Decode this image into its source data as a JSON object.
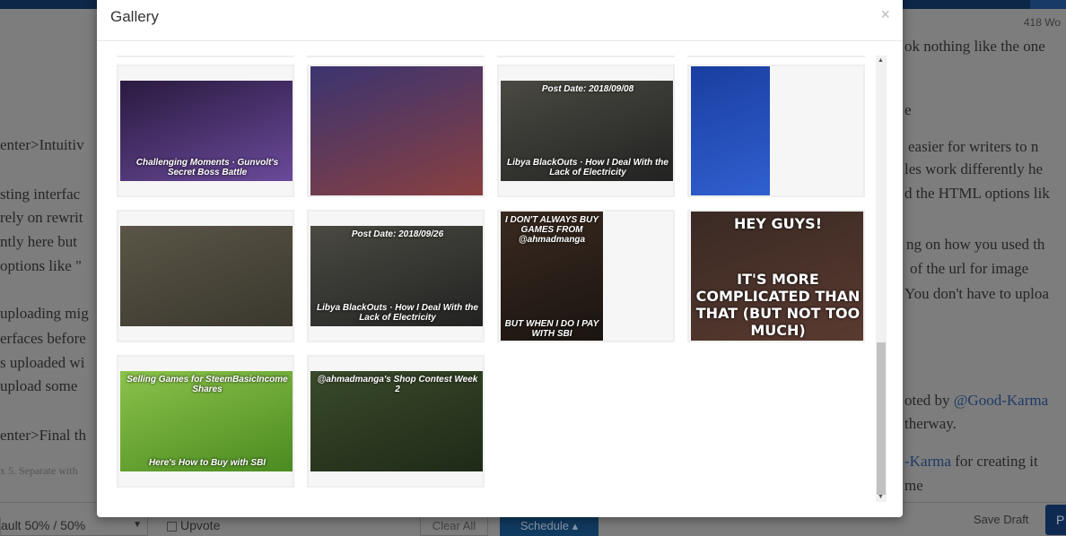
{
  "background": {
    "word_count": "418 Wo",
    "lines_left": [
      "enter>Intuitiv",
      "sting interfac",
      "rely on rewrit",
      "ntly here but",
      "options like \"",
      "uploading mig",
      "erfaces before",
      "s uploaded wi",
      "upload some",
      "enter>Final th"
    ],
    "lines_right": [
      "ok nothing like the one",
      "e",
      "easier for writers to n",
      "les work differently he",
      "d the HTML options lik",
      "ng on how you used th",
      "of the url for image",
      "You don't have to uploa",
      "oted by ",
      "therway.",
      "-Karma",
      " for creating it",
      "me"
    ],
    "link_good_karma": "@Good-Karma",
    "tags_placeholder": "x 5. Separate with",
    "beneficiary_select": "ault 50% / 50%",
    "upvote_label": "Upvote",
    "clear_all": "Clear All",
    "schedule": "Schedule ▴",
    "save_draft": "Save Draft",
    "publish": "P"
  },
  "modal": {
    "title": "Gallery",
    "close": "×",
    "images": [
      {
        "caption_top": "",
        "caption_bottom": "Challenging Moments · Gunvolt's Secret Boss Battle",
        "colors": [
          "#2a1a40",
          "#6a4a9a"
        ]
      },
      {
        "caption_top": "",
        "caption_bottom": "",
        "colors": [
          "#3b3470",
          "#8a4040"
        ]
      },
      {
        "caption_top": "Post Date: 2018/09/08",
        "caption_bottom": "Libya BlackOuts · How I Deal With the Lack of Electricity",
        "colors": [
          "#4a4a42",
          "#222"
        ]
      },
      {
        "caption_top": "",
        "caption_bottom": "",
        "colors": [
          "#1a3ea0",
          "#3060d0"
        ]
      },
      {
        "caption_top": "",
        "caption_bottom": "",
        "colors": [
          "#5a5546",
          "#3a372e"
        ]
      },
      {
        "caption_top": "Post Date: 2018/09/26",
        "caption_bottom": "Libya BlackOuts · How I Deal With the Lack of Electricity",
        "colors": [
          "#4a4a42",
          "#222"
        ]
      },
      {
        "caption_top": "I DON'T ALWAYS BUY GAMES FROM @ahmadmanga",
        "caption_bottom": "BUT WHEN I DO I PAY WITH SBI",
        "colors": [
          "#3a2a20",
          "#1a1410"
        ]
      },
      {
        "caption_top": "HEY GUYS!",
        "caption_bottom": "IT'S MORE COMPLICATED THAN THAT (BUT NOT TOO MUCH)",
        "colors": [
          "#3a2a24",
          "#5a3a30"
        ]
      },
      {
        "caption_top": "Selling Games for SteemBasicIncome Shares",
        "caption_bottom": "Here's How to Buy with SBI",
        "colors": [
          "#8bc34a",
          "#4a8a20"
        ]
      },
      {
        "caption_top": "@ahmadmanga's Shop Contest Week 2",
        "caption_bottom": "",
        "colors": [
          "#3a4a2a",
          "#1e2a18"
        ]
      }
    ]
  }
}
